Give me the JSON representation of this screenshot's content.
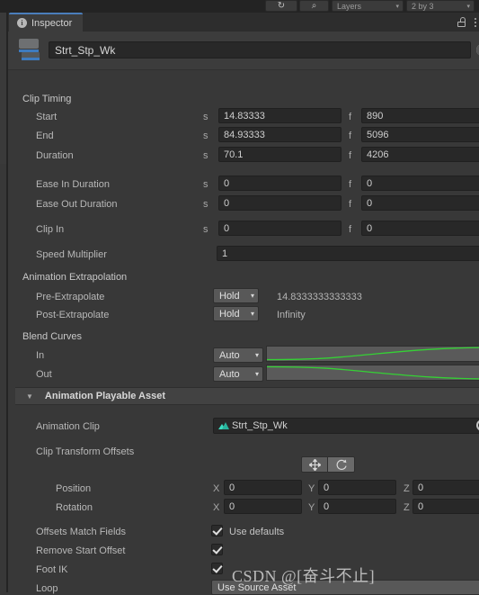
{
  "toolbar": {
    "buttons": [
      {
        "name": "history-icon",
        "label": "↻"
      },
      {
        "name": "search-icon",
        "label": "⌕"
      },
      {
        "name": "layers-dropdown",
        "label": "Layers"
      },
      {
        "name": "layout-dropdown",
        "label": "2 by 3"
      }
    ]
  },
  "window": {
    "tab_label": "Inspector",
    "info_icon": "i",
    "lock_icon": "lock-open-icon",
    "menu_icon": "kebab-menu-icon",
    "object_name": "Strt_Stp_Wk",
    "object_icon": "timeline-clip-icon",
    "preset_icon": "preset-icon"
  },
  "clip_timing": {
    "title": "Clip Timing",
    "seconds_unit": "s",
    "frames_unit": "f",
    "rows": [
      {
        "label": "Start",
        "seconds": "14.83333",
        "frames": "890"
      },
      {
        "label": "End",
        "seconds": "84.93333",
        "frames": "5096"
      },
      {
        "label": "Duration",
        "seconds": "70.1",
        "frames": "4206"
      },
      {
        "label": "Ease In Duration",
        "seconds": "0",
        "frames": "0"
      },
      {
        "label": "Ease Out Duration",
        "seconds": "0",
        "frames": "0"
      },
      {
        "label": "Clip In",
        "seconds": "0",
        "frames": "0"
      }
    ],
    "speed_multiplier": {
      "label": "Speed Multiplier",
      "value": "1"
    }
  },
  "animation_extrapolation": {
    "title": "Animation Extrapolation",
    "rows": [
      {
        "label": "Pre-Extrapolate",
        "mode": "Hold",
        "value": "14.8333333333333"
      },
      {
        "label": "Post-Extrapolate",
        "mode": "Hold",
        "value": "Infinity"
      }
    ]
  },
  "blend_curves": {
    "title": "Blend Curves",
    "rows": [
      {
        "label": "In",
        "mode": "Auto",
        "curve": "ease-in-rising"
      },
      {
        "label": "Out",
        "mode": "Auto",
        "curve": "ease-out-falling"
      }
    ]
  },
  "playable_asset": {
    "foldout_label": "Animation Playable Asset",
    "foldout_arrow": "▼",
    "animation_clip": {
      "label": "Animation Clip",
      "value": "Strt_Stp_Wk",
      "icon": "animation-clip-icon"
    },
    "clip_transform_offsets": {
      "label": "Clip Transform Offsets"
    },
    "tool_buttons": [
      {
        "name": "move-tool-button",
        "glyph": "✥"
      },
      {
        "name": "rotate-tool-button",
        "glyph": "↺"
      }
    ],
    "vectors": [
      {
        "label": "Position",
        "x": "0",
        "y": "0",
        "z": "0"
      },
      {
        "label": "Rotation",
        "x": "0",
        "y": "0",
        "z": "0"
      }
    ],
    "axis_labels": {
      "x": "X",
      "y": "Y",
      "z": "Z"
    },
    "toggles": [
      {
        "label": "Offsets Match Fields",
        "checked": true,
        "extra_label": "Use defaults"
      },
      {
        "label": "Remove Start Offset",
        "checked": true,
        "extra_label": ""
      },
      {
        "label": "Foot IK",
        "checked": true,
        "extra_label": ""
      }
    ],
    "loop": {
      "label": "Loop",
      "value": "Use Source Asset",
      "caret": "▾"
    }
  },
  "watermark": {
    "text": "CSDN @[奋斗不止]"
  },
  "colors": {
    "panel_bg": "#383838",
    "header_bg": "#3c3c3c",
    "field_bg": "#282828",
    "popup_bg": "#585858",
    "accent_tab": "#4a7ebb",
    "curve": "#35d135",
    "clip_icon_blue": "#3e7bbf",
    "anim_icon_teal": "#3ddcc0"
  }
}
